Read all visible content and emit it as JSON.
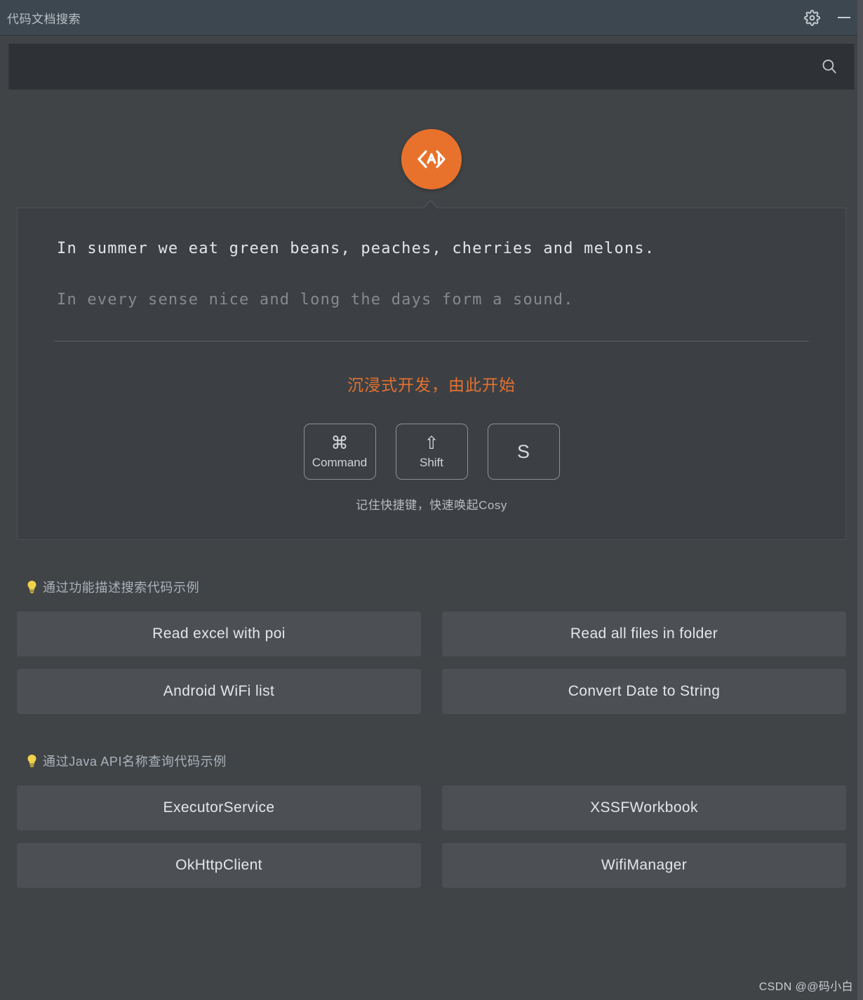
{
  "window": {
    "title": "代码文档搜索",
    "settings_icon": "gear-icon",
    "minimize_icon": "minimize-icon"
  },
  "search": {
    "value": "",
    "placeholder": "",
    "icon": "search-icon"
  },
  "logo": {
    "icon": "code-ai-logo-icon",
    "text": "AI"
  },
  "panel": {
    "quote_primary": "In summer we eat green beans, peaches, cherries and melons.",
    "quote_secondary": "In every sense nice and long the days form a sound.",
    "tagline": "沉浸式开发，由此开始",
    "shortcut_keys": [
      {
        "glyph": "⌘",
        "label": "Command",
        "name": "key-command"
      },
      {
        "glyph": "⇧",
        "label": "Shift",
        "name": "key-shift"
      },
      {
        "glyph": "S",
        "label": "",
        "name": "key-s"
      }
    ],
    "keys_caption": "记住快捷键，快速唤起Cosy"
  },
  "sections": [
    {
      "icon": "lightbulb-icon",
      "title": "通过功能描述搜索代码示例",
      "chips": [
        "Read excel with poi",
        "Read all files in folder",
        "Android WiFi list",
        "Convert Date to String"
      ]
    },
    {
      "icon": "lightbulb-icon",
      "title": "通过Java API名称查询代码示例",
      "chips": [
        "ExecutorService",
        "XSSFWorkbook",
        "OkHttpClient",
        "WifiManager"
      ]
    }
  ],
  "watermark": "CSDN @@码小白",
  "colors": {
    "accent": "#e4712f",
    "titlebar": "#3c4750",
    "background": "#414447",
    "panel": "#3c4044",
    "chip": "#4c5054",
    "search_field": "#2e3236"
  }
}
